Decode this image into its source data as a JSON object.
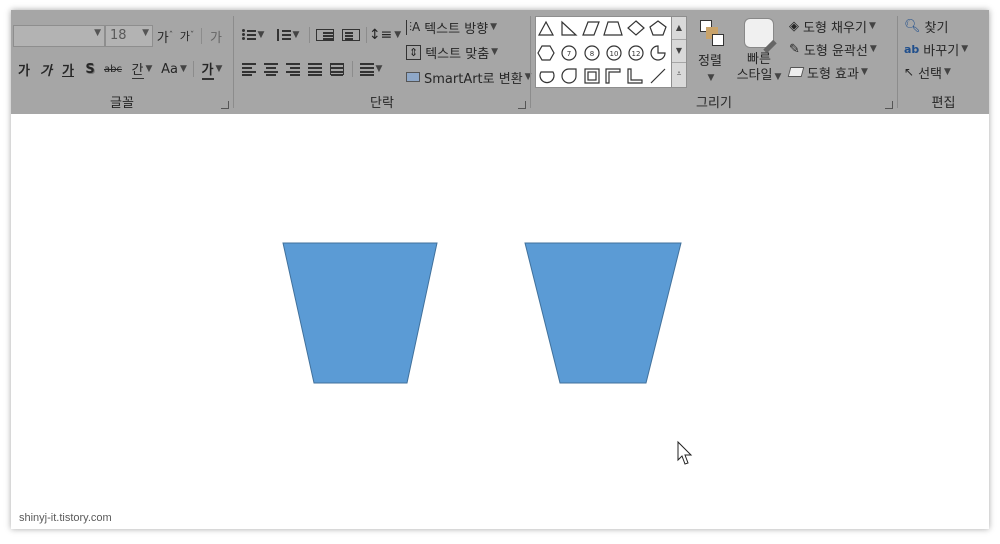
{
  "ribbon": {
    "font_group": {
      "label": "글꼴",
      "font_name": "",
      "font_size": "18",
      "grow_label": "가",
      "shrink_label": "가",
      "clear_format_label": "가",
      "bold_label": "가",
      "italic_label": "가",
      "underline_label": "가",
      "shadow_label": "S",
      "strike_label": "abc",
      "spacing_label": "간",
      "case_label": "Aa",
      "color_label": "가"
    },
    "paragraph_group": {
      "label": "단락",
      "text_direction": "텍스트 방향",
      "align_text": "텍스트 맞춤",
      "smartart": "SmartArt로 변환"
    },
    "drawing_group": {
      "label": "그리기",
      "arrange": "정렬",
      "quick_styles_line1": "빠른",
      "quick_styles_line2": "스타일",
      "shape_fill": "도형 채우기",
      "shape_outline": "도형 윤곽선",
      "shape_effects": "도형 효과",
      "shape_numbers": [
        "7",
        "8",
        "10",
        "12"
      ]
    },
    "editing_group": {
      "label": "편집",
      "find": "찾기",
      "replace": "바꾸기",
      "select": "선택"
    }
  },
  "canvas": {
    "shape_color": "#5b9bd5",
    "shape_outline": "#41719c",
    "watermark": "shinyj-it.tistory.com"
  },
  "colors": {
    "ribbon_bg": "#a6a6a6",
    "slide_bg": "#ffffff"
  }
}
